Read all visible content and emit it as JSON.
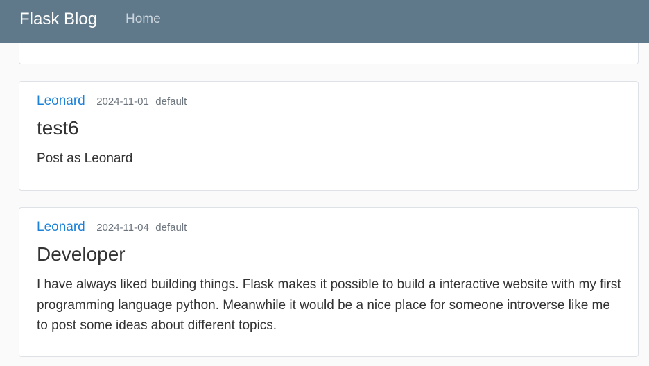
{
  "nav": {
    "brand": "Flask Blog",
    "home": "Home"
  },
  "posts": [
    {
      "author": "Leonard",
      "date": "2024-11-01",
      "category": "default",
      "title": "test6",
      "content": "Post as Leonard"
    },
    {
      "author": "Leonard",
      "date": "2024-11-04",
      "category": "default",
      "title": "Developer",
      "content": "I have always liked building things. Flask makes it possible to build a interactive website with my first programming language python. Meanwhile it would be a nice place for someone introverse like me to post some ideas about different topics."
    }
  ]
}
